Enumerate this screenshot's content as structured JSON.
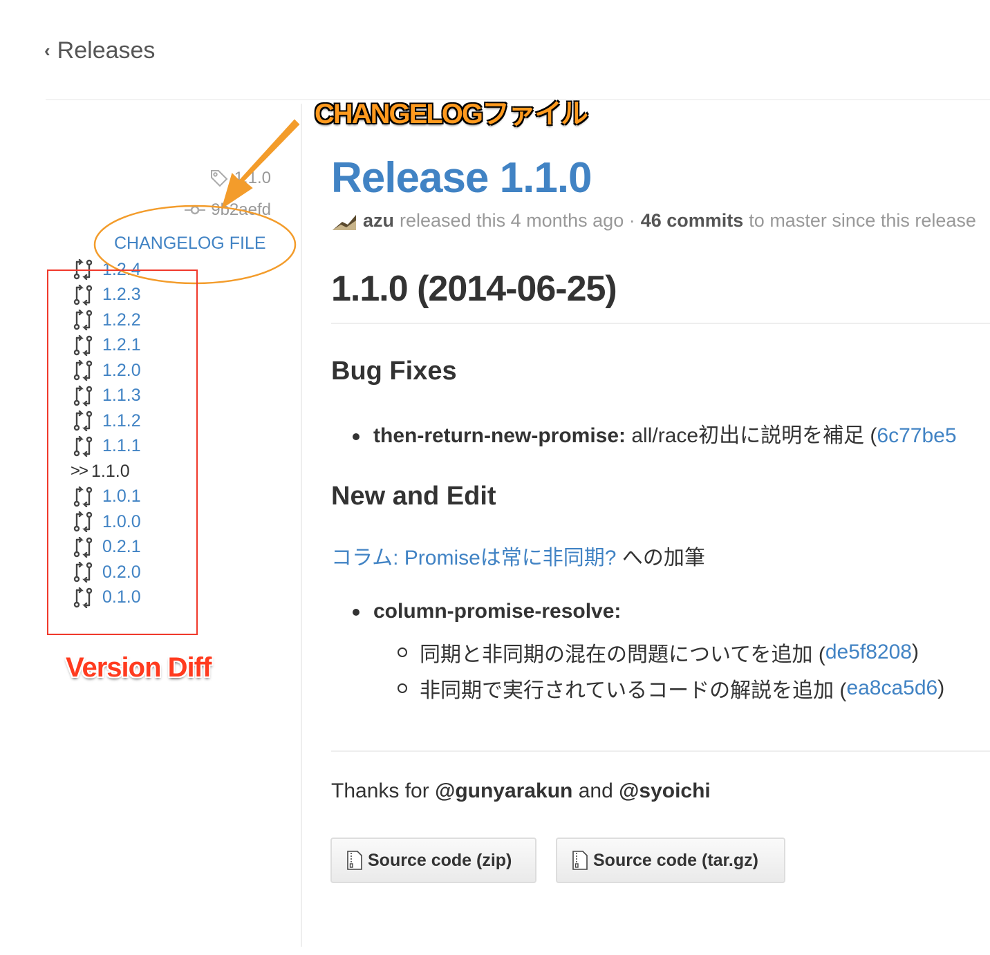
{
  "nav": {
    "back_label": "Releases"
  },
  "sidebar": {
    "tag": "1.1.0",
    "commit": "9b2aefd",
    "changelog_link": "CHANGELOG FILE",
    "current_marker": ">>",
    "versions": [
      {
        "label": "1.2.4",
        "current": false
      },
      {
        "label": "1.2.3",
        "current": false
      },
      {
        "label": "1.2.2",
        "current": false
      },
      {
        "label": "1.2.1",
        "current": false
      },
      {
        "label": "1.2.0",
        "current": false
      },
      {
        "label": "1.1.3",
        "current": false
      },
      {
        "label": "1.1.2",
        "current": false
      },
      {
        "label": "1.1.1",
        "current": false
      },
      {
        "label": "1.1.0",
        "current": true
      },
      {
        "label": "1.0.1",
        "current": false
      },
      {
        "label": "1.0.0",
        "current": false
      },
      {
        "label": "0.2.1",
        "current": false
      },
      {
        "label": "0.2.0",
        "current": false
      },
      {
        "label": "0.1.0",
        "current": false
      }
    ]
  },
  "annotations": {
    "changelog_callout": "CHANGELOGファイル",
    "version_diff": "Version Diff",
    "arrow_color": "#f39c2b",
    "ellipse_color": "#f39c2b",
    "box_color": "#f0392b"
  },
  "release": {
    "title": "Release 1.1.0",
    "author": "azu",
    "released_text": "released this 4 months ago ·",
    "commits": "46 commits",
    "commits_suffix": "to master since this release",
    "heading": "1.1.0 (2014-06-25)",
    "section1": "Bug Fixes",
    "bug_item_key": "then-return-new-promise:",
    "bug_item_text": "all/race初出に説明を補足 (",
    "bug_item_hash": "6c77be5",
    "section2": "New and Edit",
    "para_link": "コラム: Promiseは常に非同期?",
    "para_text": "への加筆",
    "item2_key": "column-promise-resolve:",
    "sub_items": [
      {
        "text": "同期と非同期の混在の問題についてを追加 (",
        "hash": "de5f8208",
        "close": ")"
      },
      {
        "text": "非同期で実行されているコードの解説を追加 (",
        "hash": "ea8ca5d6",
        "close": ")"
      }
    ],
    "thanks_prefix": "Thanks for",
    "thanks_user1": "@gunyarakun",
    "thanks_and": "and",
    "thanks_user2": "@syoichi",
    "btn_zip": "Source code (zip)",
    "btn_tar": "Source code (tar.gz)"
  },
  "colors": {
    "link": "#4183c4",
    "text": "#333333",
    "muted": "#999999"
  }
}
